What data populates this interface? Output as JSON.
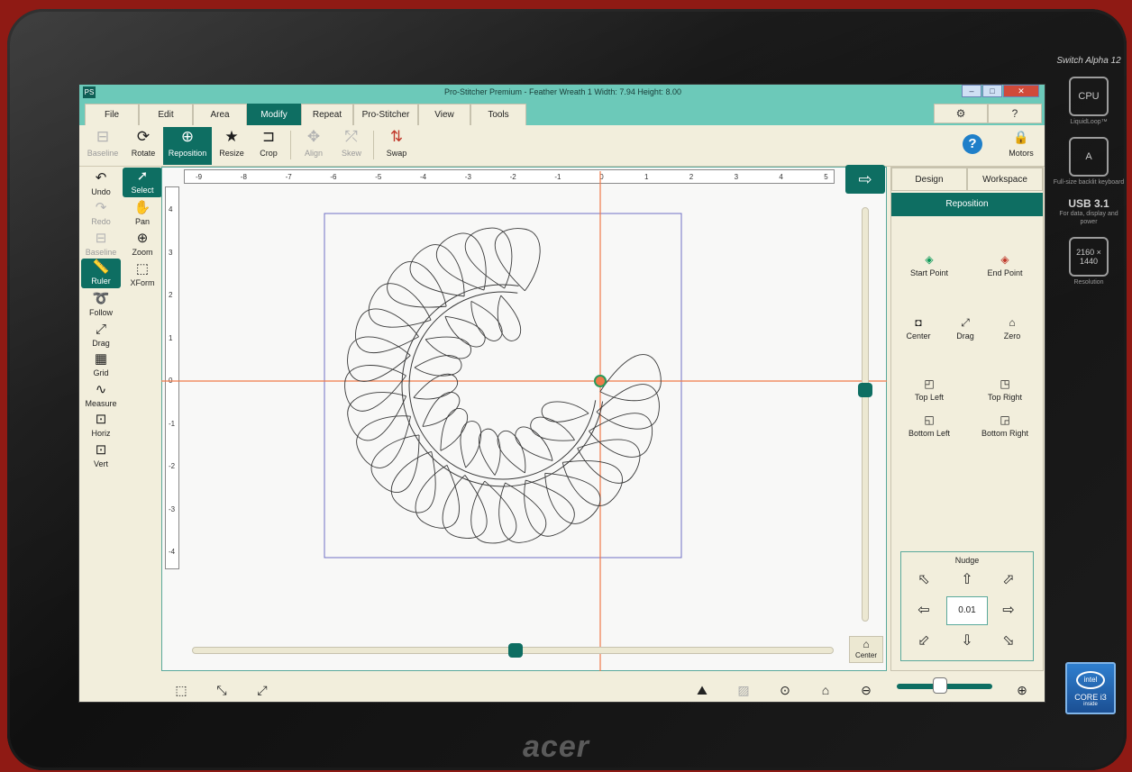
{
  "device": {
    "brand": "acer",
    "model": "Switch Alpha 12",
    "specs": [
      {
        "icon": "cpu-icon",
        "text": "LiquidLoop™",
        "glyph": "CPU"
      },
      {
        "icon": "keyboard-icon",
        "text": "Full-size backlit keyboard",
        "glyph": "A"
      },
      {
        "icon": "usb-c-icon",
        "text": "For data, display and power",
        "glyph": "USB 3.1"
      },
      {
        "icon": "resolution-icon",
        "text": "Resolution",
        "glyph": "2160 × 1440"
      }
    ],
    "badge": {
      "brand": "intel",
      "text": "CORE i3",
      "sub": "inside"
    }
  },
  "window": {
    "app_icon": "PS",
    "title": "Pro-Stitcher Premium   -   Feather Wreath 1   Width: 7.94   Height: 8.00",
    "controls": [
      "–",
      "□",
      "✕"
    ]
  },
  "menu": {
    "tabs": [
      "File",
      "Edit",
      "Area",
      "Modify",
      "Repeat",
      "Pro-Stitcher",
      "View",
      "Tools"
    ],
    "active": "Modify",
    "settings_icon": "⚙",
    "help_icon": "?"
  },
  "ribbon": {
    "buttons": [
      {
        "label": "Baseline",
        "glyph": "⊟",
        "state": "disabled"
      },
      {
        "label": "Rotate",
        "glyph": "⟳",
        "state": "normal"
      },
      {
        "label": "Reposition",
        "glyph": "⊕",
        "state": "active"
      },
      {
        "label": "Resize",
        "glyph": "★",
        "state": "normal"
      },
      {
        "label": "Crop",
        "glyph": "⊐",
        "state": "normal"
      },
      {
        "label": "Align",
        "glyph": "✥",
        "state": "disabled"
      },
      {
        "label": "Skew",
        "glyph": "⤱",
        "state": "disabled"
      },
      {
        "label": "Swap",
        "glyph": "⇅",
        "state": "normal"
      }
    ],
    "help": "?",
    "motors_label": "Motors",
    "motors_glyph": "🔒"
  },
  "left_tools": {
    "col1": [
      {
        "label": "Undo",
        "glyph": "↶",
        "state": "normal"
      },
      {
        "label": "Redo",
        "glyph": "↷",
        "state": "disabled"
      },
      {
        "label": "Baseline",
        "glyph": "⊟",
        "state": "disabled"
      },
      {
        "label": "Ruler",
        "glyph": "📏",
        "state": "active"
      },
      {
        "label": "Follow",
        "glyph": "➰",
        "state": "normal"
      },
      {
        "label": "Drag",
        "glyph": "⤢",
        "state": "normal"
      },
      {
        "label": "Grid",
        "glyph": "▦",
        "state": "normal"
      },
      {
        "label": "Measure",
        "glyph": "∿",
        "state": "normal"
      },
      {
        "label": "Horiz",
        "glyph": "⊡",
        "state": "normal"
      },
      {
        "label": "Vert",
        "glyph": "⊡",
        "state": "normal"
      }
    ],
    "col2": [
      {
        "label": "Select",
        "glyph": "➚",
        "state": "active"
      },
      {
        "label": "Pan",
        "glyph": "✋",
        "state": "normal"
      },
      {
        "label": "Zoom",
        "glyph": "⊕",
        "state": "normal"
      },
      {
        "label": "XForm",
        "glyph": "⬚",
        "state": "normal"
      }
    ]
  },
  "rulers": {
    "top": [
      "-9",
      "-8",
      "-7",
      "-6",
      "-5",
      "-4",
      "-3",
      "-2",
      "-1",
      "0",
      "1",
      "2",
      "3",
      "4",
      "5"
    ],
    "left": [
      "4",
      "3",
      "2",
      "1",
      "0",
      "-1",
      "-2",
      "-3",
      "-4"
    ]
  },
  "canvas": {
    "next_arrow": "⇨",
    "center_label": "Center",
    "center_glyph": "⌂",
    "vslider": 0.44,
    "hslider": 0.5
  },
  "right_panel": {
    "tabs": [
      "Design",
      "Workspace"
    ],
    "header": "Reposition",
    "buttons": [
      {
        "label": "Start Point",
        "glyph": "◈"
      },
      {
        "label": "End Point",
        "glyph": "◈"
      },
      {
        "label": "Center",
        "glyph": "◘"
      },
      {
        "label": "Drag",
        "glyph": "⤢"
      },
      {
        "label": "Zero",
        "glyph": "⌂"
      },
      {
        "label": "Top Left",
        "glyph": "◰"
      },
      {
        "label": "Top Right",
        "glyph": "◳"
      },
      {
        "label": "Bottom Left",
        "glyph": "◱"
      },
      {
        "label": "Bottom Right",
        "glyph": "◲"
      }
    ],
    "nudge": {
      "title": "Nudge",
      "value": "0.01",
      "arrows": [
        "⬁",
        "⇧",
        "⬀",
        "⇦",
        "⇨",
        "⬃",
        "⇩",
        "⬂"
      ]
    }
  },
  "bottom_bar": {
    "left_icons": [
      {
        "name": "fit-design-icon",
        "glyph": "⬚"
      },
      {
        "name": "shrink-icon",
        "glyph": "⤡"
      },
      {
        "name": "expand-icon",
        "glyph": "⤢"
      }
    ],
    "right_icons": [
      {
        "name": "image-view-icon",
        "glyph": "⛰"
      },
      {
        "name": "image-disabled-icon",
        "glyph": "▨"
      },
      {
        "name": "zoom-fit-icon",
        "glyph": "⊙"
      },
      {
        "name": "home-view-icon",
        "glyph": "⌂"
      },
      {
        "name": "zoom-out-icon",
        "glyph": "⊖"
      },
      {
        "name": "zoom-in-icon",
        "glyph": "⊕"
      }
    ],
    "zoom_level": 0.45
  },
  "colors": {
    "accent": "#0e6e62",
    "titlebar": "#6cc9b9",
    "panel": "#f2eedc",
    "crosshair": "#f07a4a",
    "boundary": "#6f6fc4"
  }
}
